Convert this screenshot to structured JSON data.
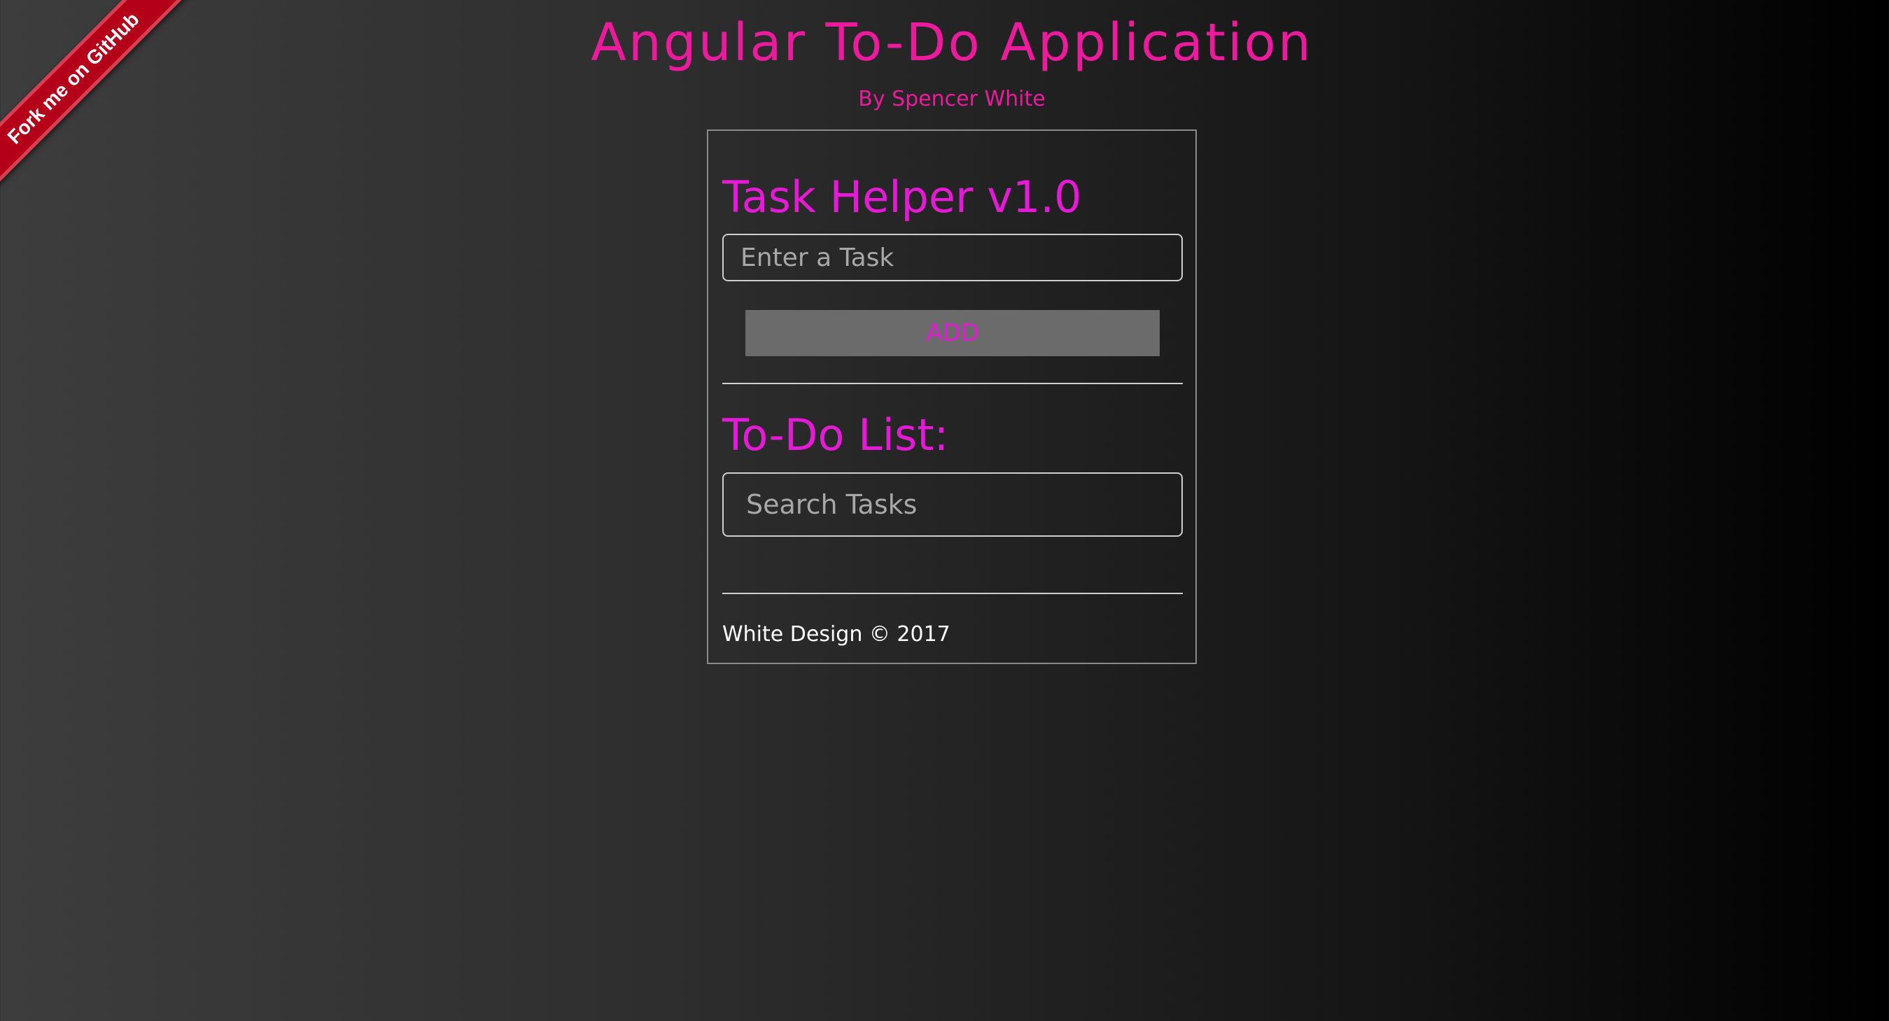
{
  "ribbon": {
    "label": "Fork me on GitHub"
  },
  "header": {
    "title": "Angular To-Do Application",
    "subtitle": "By Spencer White"
  },
  "panel": {
    "task_heading": "Task Helper v1.0",
    "task_input": {
      "placeholder": "Enter a Task",
      "value": ""
    },
    "add_button_label": "ADD",
    "list_heading": "To-Do List:",
    "search_input": {
      "placeholder": "Search Tasks",
      "value": ""
    },
    "todo_items": [],
    "footer": "White Design © 2017"
  },
  "colors": {
    "title": "#ec1a9c",
    "heading": "#e51ad6",
    "button_bg": "#6b6b6b",
    "ribbon": "#b5001a"
  }
}
